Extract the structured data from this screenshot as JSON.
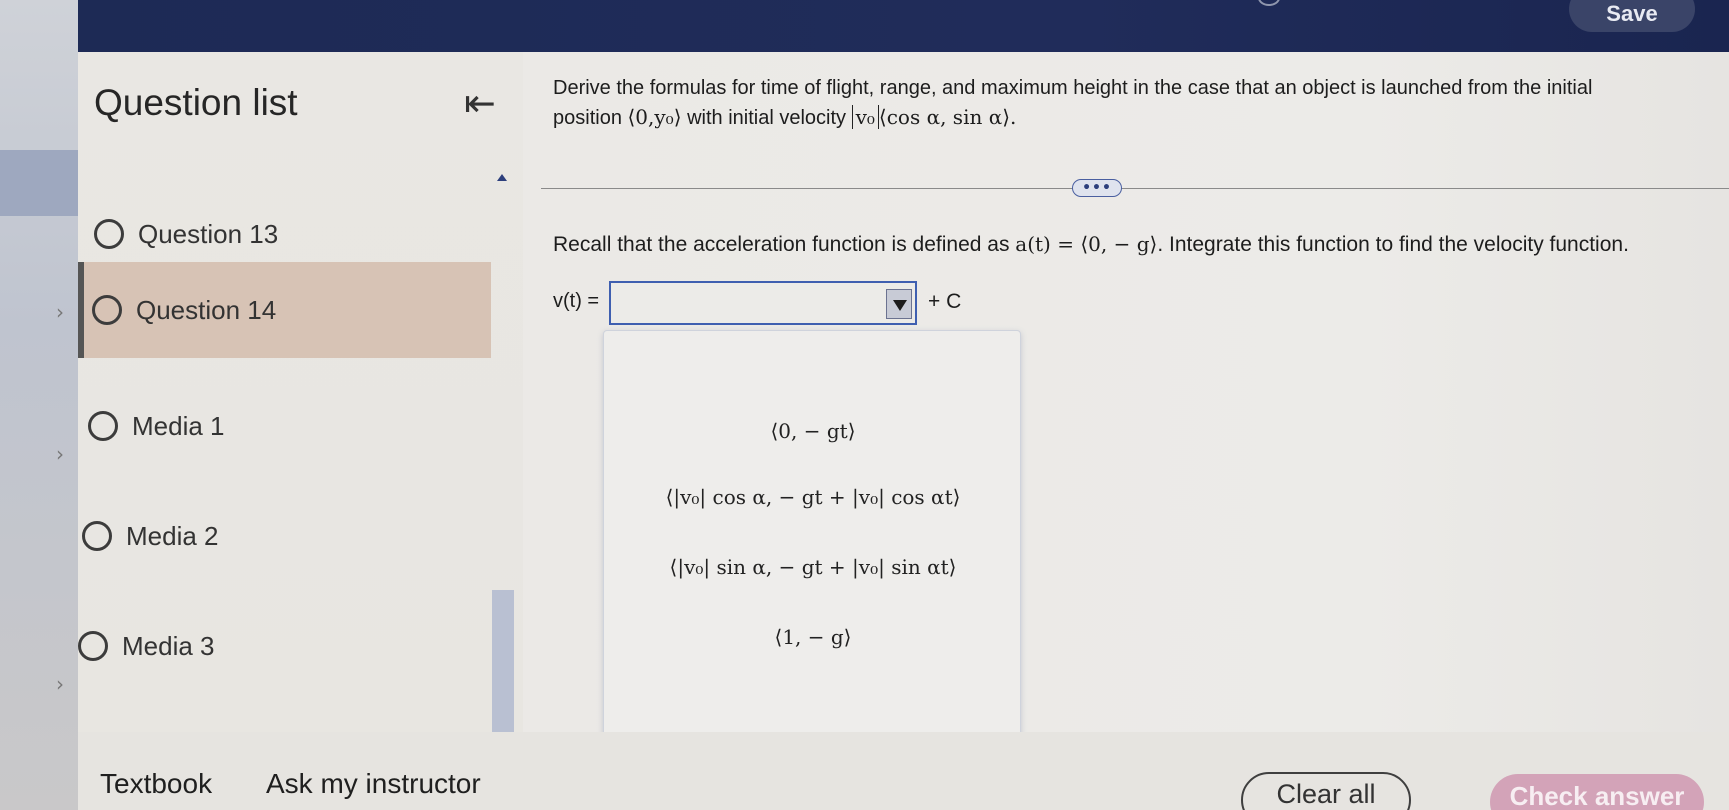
{
  "topbar": {
    "save_label": "Save"
  },
  "sidebar": {
    "title": "Question list",
    "items": [
      {
        "label": "Question 13",
        "selected": false
      },
      {
        "label": "Question 14",
        "selected": true
      },
      {
        "label": "Media 1",
        "selected": false
      },
      {
        "label": "Media 2",
        "selected": false
      },
      {
        "label": "Media 3",
        "selected": false
      }
    ]
  },
  "question": {
    "prompt_line1": "Derive the formulas for time of flight, range, and maximum height in the case that an object is launched from the initial",
    "prompt_line2_a": "position",
    "prompt_pos": "⟨0,y₀⟩",
    "prompt_line2_b": "with initial velocity",
    "prompt_v0": "v₀",
    "prompt_vec": "⟨cos α, sin α⟩.",
    "recall_text": "Recall that the acceleration function is defined as",
    "accel_expr": "a(t) = ⟨0, − g⟩",
    "recall_tail": ". Integrate this function to find the velocity function.",
    "vt_label": "v(t) =",
    "plus_c": "+ C"
  },
  "dropdown": {
    "selected": "",
    "options": [
      "⟨0, − gt⟩",
      "⟨|v₀| cos α, − gt + |v₀| cos αt⟩",
      "⟨|v₀| sin α, − gt + |v₀| sin αt⟩",
      "⟨1, − g⟩"
    ]
  },
  "more_button": "•••",
  "bottom": {
    "textbook": "Textbook",
    "ask_instructor": "Ask my instructor",
    "clear_all": "Clear all",
    "check_answer": "Check answer"
  }
}
